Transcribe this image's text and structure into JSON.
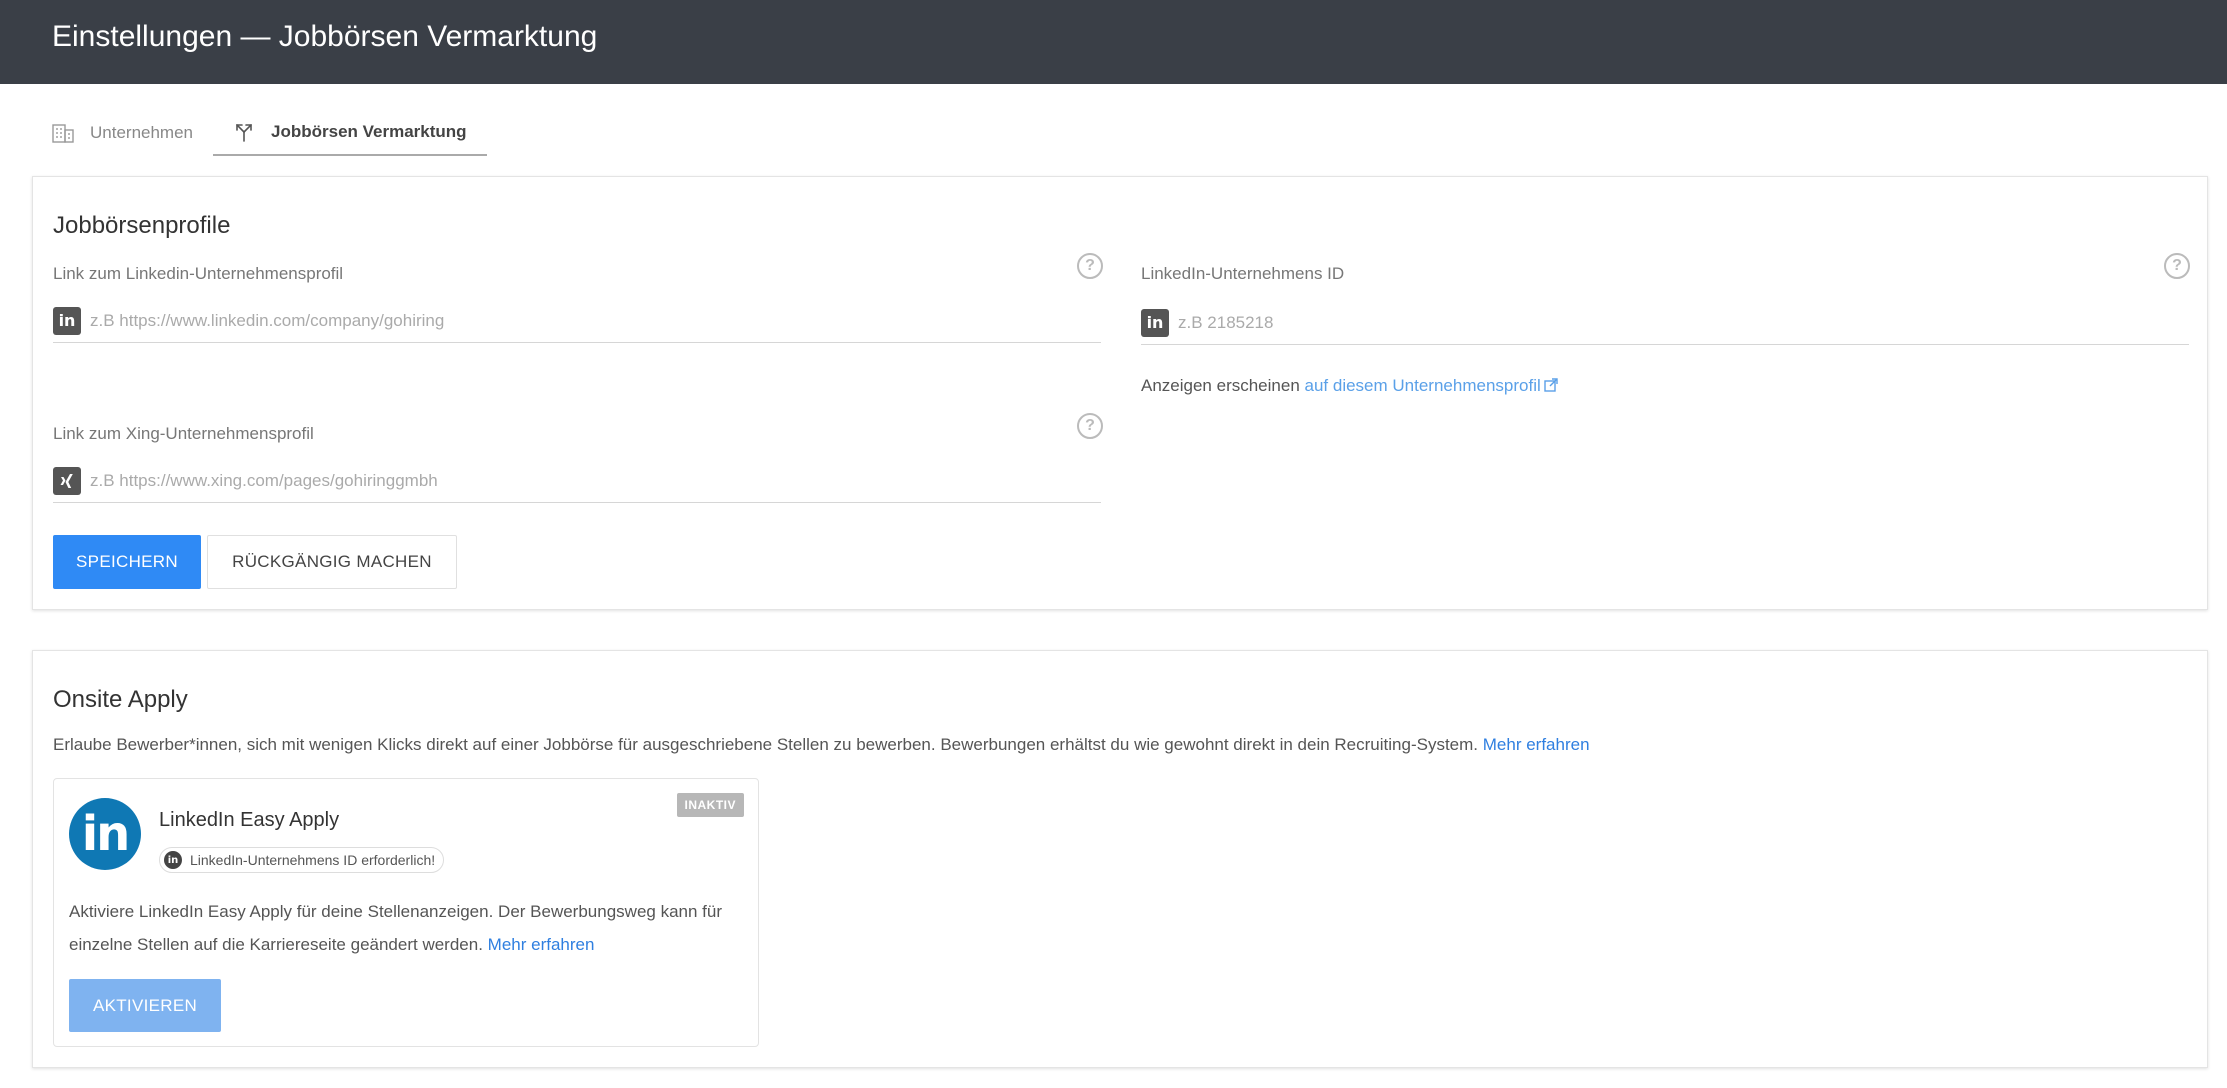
{
  "header": {
    "title": "Einstellungen — Jobbörsen Vermarktung"
  },
  "tabs": [
    {
      "label": "Unternehmen",
      "icon": "building-icon",
      "active": false
    },
    {
      "label": "Jobbörsen Vermarktung",
      "icon": "share-icon",
      "active": true
    }
  ],
  "profiles": {
    "title": "Jobbörsenprofile",
    "linkedin_link": {
      "label": "Link zum Linkedin-Unternehmensprofil",
      "placeholder": "z.B https://www.linkedin.com/company/gohiring",
      "value": ""
    },
    "xing_link": {
      "label": "Link zum Xing-Unternehmensprofil",
      "placeholder": "z.B https://www.xing.com/pages/gohiringgmbh",
      "value": ""
    },
    "linkedin_id": {
      "label": "LinkedIn-Unternehmens ID",
      "placeholder": "z.B 2185218",
      "value": ""
    },
    "note_prefix": "Anzeigen erscheinen",
    "note_link": "auf diesem Unternehmensprofil",
    "save_label": "SPEICHERN",
    "undo_label": "RÜCKGÄNGIG MACHEN"
  },
  "onsite": {
    "title": "Onsite Apply",
    "description": "Erlaube Bewerber*innen, sich mit wenigen Klicks direkt auf einer Jobbörse für ausgeschriebene Stellen zu bewerben. Bewerbungen erhältst du wie gewohnt direkt in dein Recruiting-System.",
    "more_link": "Mehr erfahren",
    "easy_apply": {
      "title": "LinkedIn Easy Apply",
      "status": "INAKTIV",
      "requirement": "LinkedIn-Unternehmens ID erforderlich!",
      "description": "Aktiviere LinkedIn Easy Apply für deine Stellenanzeigen. Der Bewerbungsweg kann für einzelne Stellen auf die Karriereseite geändert werden.",
      "more_link": "Mehr erfahren",
      "activate_label": "AKTIVIEREN"
    }
  },
  "colors": {
    "header_bg": "#3a3f47",
    "primary": "#2f8af5",
    "link": "#2f7fe0",
    "linkedin_brand": "#0f78b4",
    "status_inactive": "#b7b7b7"
  }
}
